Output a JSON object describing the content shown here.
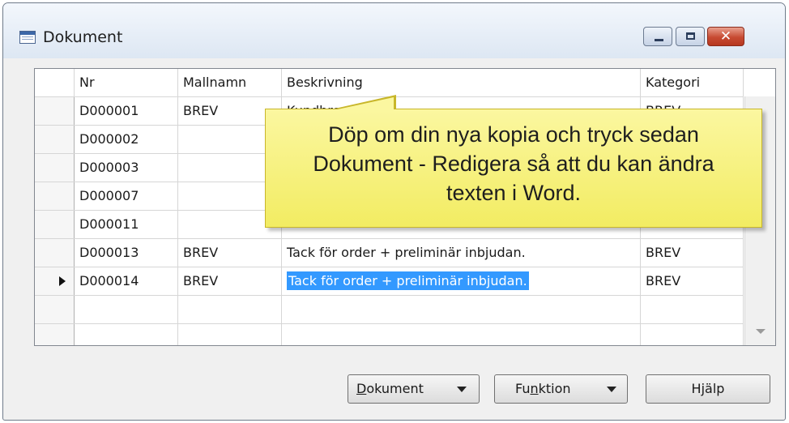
{
  "window": {
    "title": "Dokument",
    "controls": {
      "minimize": "minimize",
      "maximize": "maximize",
      "close": "✕"
    }
  },
  "grid": {
    "columns": [
      "Nr",
      "Mallnamn",
      "Beskrivning",
      "Kategori"
    ],
    "rows": [
      {
        "nr": "D000001",
        "mall": "BREV",
        "besk": "Kundbrev A...M",
        "kat": "BREV"
      },
      {
        "nr": "D000002",
        "mall": "",
        "besk": "",
        "kat": ""
      },
      {
        "nr": "D000003",
        "mall": "",
        "besk": "",
        "kat": ""
      },
      {
        "nr": "D000007",
        "mall": "",
        "besk": "",
        "kat": ""
      },
      {
        "nr": "D000011",
        "mall": "",
        "besk": "",
        "kat": ""
      },
      {
        "nr": "D000013",
        "mall": "BREV",
        "besk": "Tack för order + preliminär inbjudan.",
        "kat": "BREV"
      },
      {
        "nr": "D000014",
        "mall": "BREV",
        "besk": "Tack för order + preliminär inbjudan.",
        "kat": "BREV"
      },
      {
        "nr": "",
        "mall": "",
        "besk": "",
        "kat": ""
      },
      {
        "nr": "",
        "mall": "",
        "besk": "",
        "kat": ""
      }
    ],
    "current_row": 7
  },
  "tooltip": {
    "lines": [
      "Döp om din nya kopia och tryck sedan",
      "Dokument - Redigera så att du kan ändra",
      "texten i Word."
    ]
  },
  "buttons": {
    "dokument": {
      "first": "D",
      "rest": "okument"
    },
    "funktion": {
      "first": "Fu",
      "mid": "n",
      "rest": "ktion"
    },
    "hjalp": "Hjälp"
  }
}
